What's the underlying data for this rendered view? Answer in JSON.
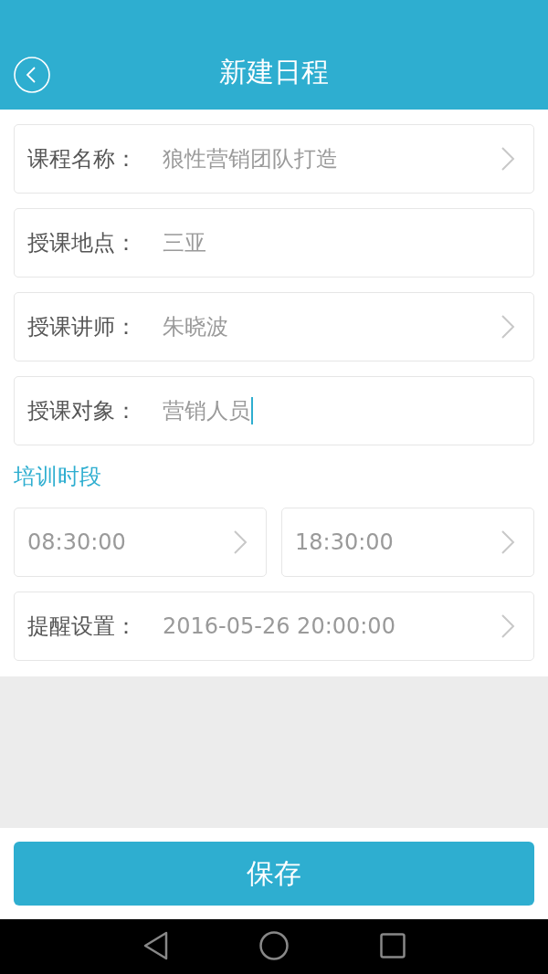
{
  "header": {
    "title": "新建日程"
  },
  "fields": [
    {
      "kind": "picker",
      "label": "课程名称：",
      "value": "狼性营销团队打造",
      "focused": false
    },
    {
      "kind": "text",
      "label": "授课地点：",
      "value": "三亚",
      "focused": false
    },
    {
      "kind": "picker",
      "label": "授课讲师：",
      "value": "朱晓波",
      "focused": false
    },
    {
      "kind": "text",
      "label": "授课对象：",
      "value": "营销人员",
      "focused": true
    }
  ],
  "section_title": "培训时段",
  "time_range": [
    {
      "kind": "picker",
      "value": "08:30:00"
    },
    {
      "kind": "picker",
      "value": "18:30:00"
    }
  ],
  "reminder": {
    "kind": "picker",
    "label": "提醒设置：",
    "value": "2016-05-26 20:00:00"
  },
  "save_button": "保存"
}
